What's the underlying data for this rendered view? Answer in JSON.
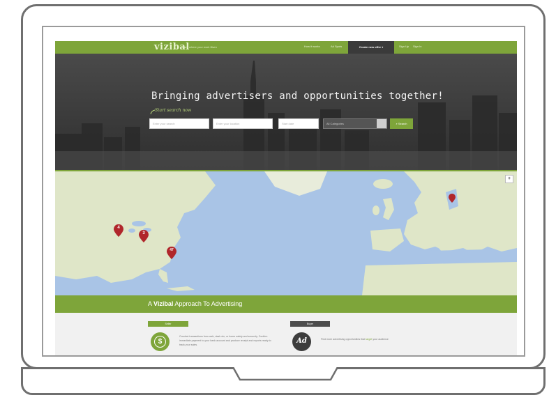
{
  "nav": {
    "logo": "vizibal",
    "tagline": "learn where your work fitwm",
    "links": [
      "How it works",
      "Ad Spots",
      "Sign Up",
      "Sign In"
    ],
    "cta_label": "Create new offer ▾"
  },
  "hero": {
    "title": "Bringing advertisers and opportunities together!",
    "hint": "Start search now",
    "fields": [
      {
        "placeholder": "Enter your search"
      },
      {
        "placeholder": "Enter your location"
      },
      {
        "placeholder": "Start date"
      }
    ],
    "category_value": "All Categories",
    "search_label": "Search"
  },
  "map": {
    "markers": [
      {
        "label": "4"
      },
      {
        "label": "3"
      },
      {
        "label": "47"
      },
      {
        "label": ""
      }
    ],
    "zoom_label": "+"
  },
  "approach": {
    "prefix": "A",
    "brand": "Vizibal",
    "suffix": "Approach To Advertising"
  },
  "seller": {
    "tag": "Seller",
    "icon_symbol": "$",
    "description": "Conduct transactions from web, dash etc, or home safely and securely. Confirm immediate payment to your bank account and produce receipt and reports ready to track your sales."
  },
  "buyer": {
    "tag": "Buyer",
    "icon_symbol": "Ad",
    "description_prefix": "Find more advertising opportunities that ",
    "description_highlight": "target",
    "description_suffix": " your audience"
  },
  "colors": {
    "brand_green": "#7ea53a",
    "dark_gray": "#3a3a3a",
    "marker_red": "#b0262b",
    "ocean": "#a9c4e6",
    "land": "#dfe6c8"
  }
}
